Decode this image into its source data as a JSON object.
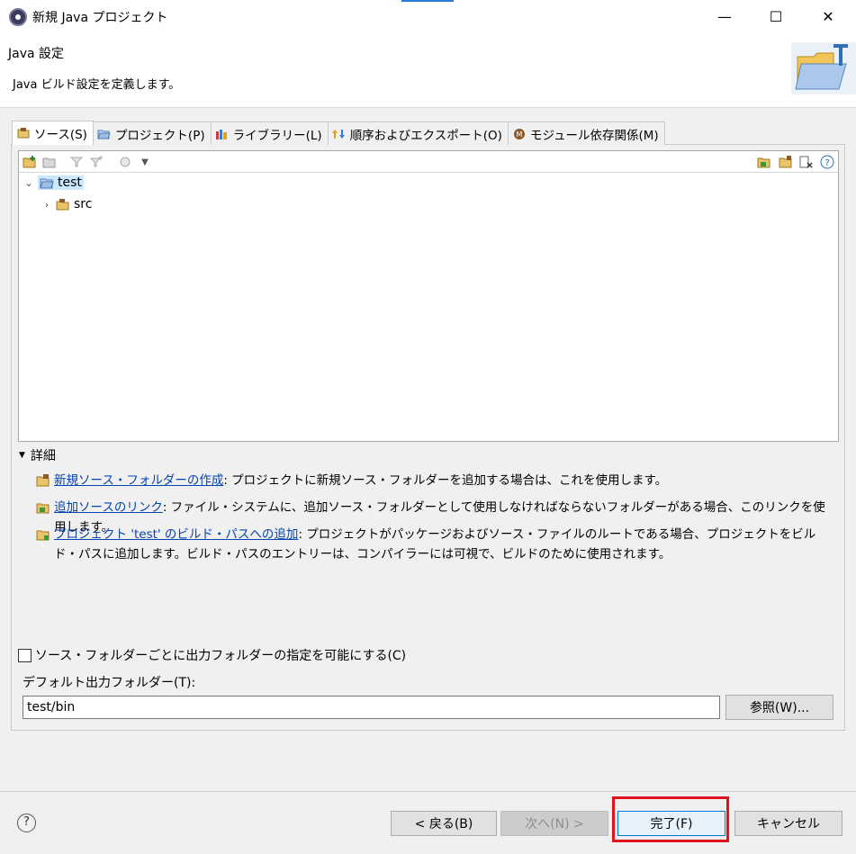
{
  "window": {
    "title": "新規 Java プロジェクト",
    "controls": {
      "minimize": "—",
      "maximize": "☐",
      "close": "✕"
    }
  },
  "header": {
    "title": "Java 設定",
    "description": "Java ビルド設定を定義します。"
  },
  "tabs": [
    {
      "label": "ソース(S)",
      "icon": "source-folder-icon",
      "active": true
    },
    {
      "label": "プロジェクト(P)",
      "icon": "project-icon",
      "active": false
    },
    {
      "label": "ライブラリー(L)",
      "icon": "library-icon",
      "active": false
    },
    {
      "label": "順序およびエクスポート(O)",
      "icon": "order-export-icon",
      "active": false
    },
    {
      "label": "モジュール依存関係(M)",
      "icon": "module-icon",
      "active": false
    }
  ],
  "tree": {
    "items": [
      {
        "label": "test",
        "expanded": true,
        "selected": true,
        "level": 0
      },
      {
        "label": "src",
        "expanded": false,
        "selected": false,
        "level": 1
      }
    ]
  },
  "details": {
    "toggle_label": "詳細",
    "rows": [
      {
        "link": "新規ソース・フォルダーの作成",
        "text": ": プロジェクトに新規ソース・フォルダーを追加する場合は、これを使用します。"
      },
      {
        "link": "追加ソースのリンク",
        "text": ": ファイル・システムに、追加ソース・フォルダーとして使用しなければならないフォルダーがある場合、このリンクを使用します。"
      },
      {
        "link": "プロジェクト 'test' のビルド・パスへの追加",
        "text": ": プロジェクトがパッケージおよびソース・ファイルのルートである場合、プロジェクトをビルド・パスに追加します。ビルド・パスのエントリーは、コンパイラーには可視で、ビルドのために使用されます。"
      }
    ]
  },
  "options": {
    "checkbox_label": "ソース・フォルダーごとに出力フォルダーの指定を可能にする(C)",
    "checkbox_checked": false,
    "output_label": "デフォルト出力フォルダー(T):",
    "output_value": "test/bin",
    "browse_label": "参照(W)..."
  },
  "footer": {
    "help": "?",
    "back": "< 戻る(B)",
    "next": "次へ(N) >",
    "finish": "完了(F)",
    "cancel": "キャンセル"
  },
  "colors": {
    "highlight": "#e0141e",
    "link": "#0645ad",
    "selection": "#cce8ff"
  }
}
